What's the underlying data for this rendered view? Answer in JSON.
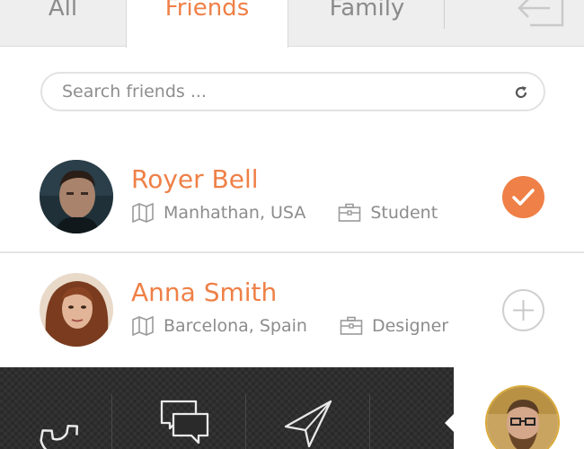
{
  "tabs": [
    {
      "label": "All",
      "active": false
    },
    {
      "label": "Friends",
      "active": true
    },
    {
      "label": "Family",
      "active": false
    }
  ],
  "search": {
    "placeholder": "Search friends ..."
  },
  "friends": [
    {
      "name": "Royer Bell",
      "location": "Manhathan, USA",
      "occupation": "Student",
      "status": "added"
    },
    {
      "name": "Anna Smith",
      "location": "Barcelona, Spain",
      "occupation": "Designer",
      "status": "add"
    }
  ],
  "bottom_nav": [
    {
      "icon": "phone-icon"
    },
    {
      "icon": "chat-bubbles-icon"
    },
    {
      "icon": "send-icon"
    }
  ],
  "colors": {
    "accent": "#ef8047",
    "dark_bar": "#2a2a2a"
  }
}
